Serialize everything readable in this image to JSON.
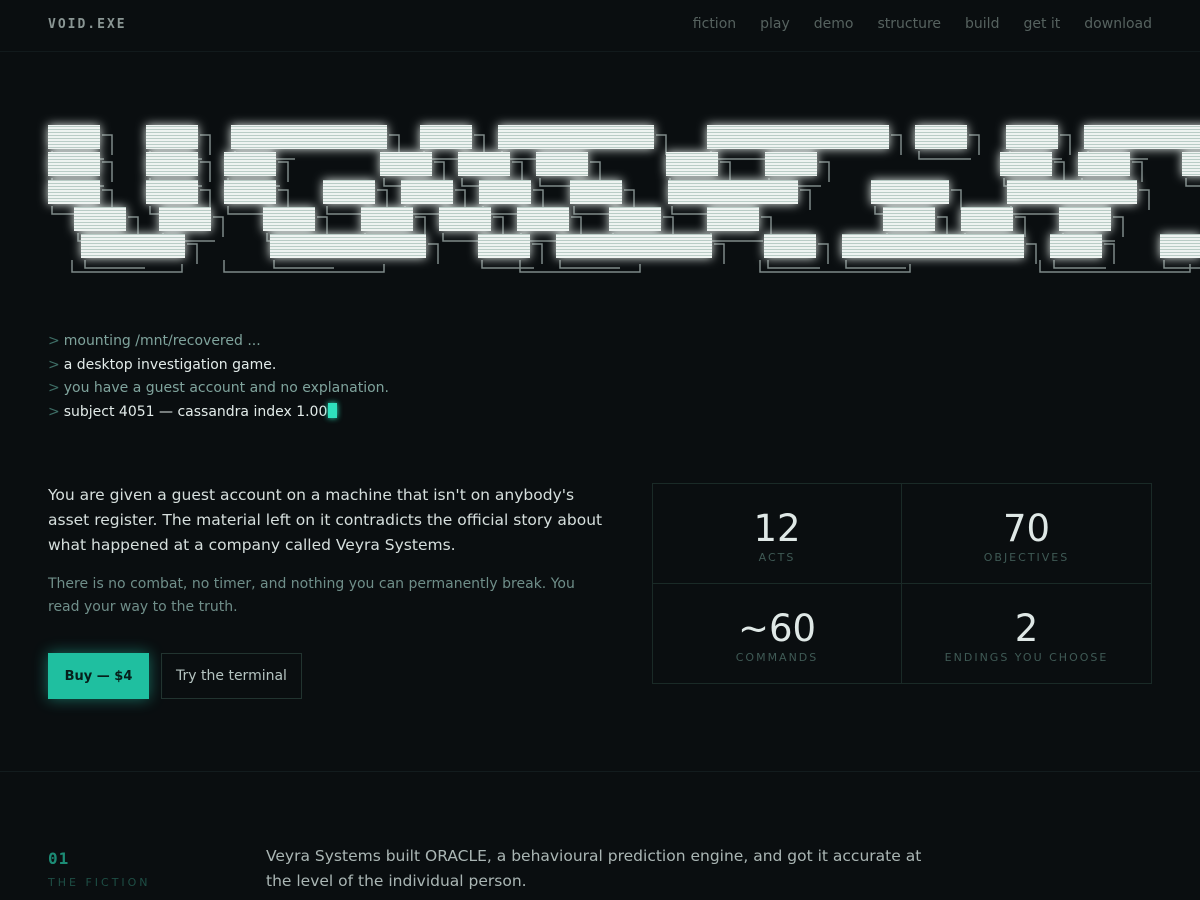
{
  "nav": {
    "brand": "VOID.EXE",
    "links": [
      "fiction",
      "play",
      "demo",
      "structure",
      "build",
      "get it",
      "download"
    ]
  },
  "terminal": {
    "prompt": ">",
    "lines": [
      "mounting /mnt/recovered ...",
      "a desktop investigation game.",
      "you have a guest account and no explanation.",
      "subject 4051 — cassandra index 1.00"
    ]
  },
  "intro": {
    "text": "You are given a guest account on a machine that isn't on anybody's asset register. The material left on it contradicts the official story about what happened at a company called Veyra Systems.",
    "sub": "There is no combat, no timer, and nothing you can permanently break. You read your way to the truth."
  },
  "buttons": {
    "buy": "Buy — $4",
    "try": "Try the terminal"
  },
  "stats": [
    {
      "value": "12",
      "label": "ACTS"
    },
    {
      "value": "70",
      "label": "OBJECTIVES"
    },
    {
      "value": "~60",
      "label": "COMMANDS"
    },
    {
      "value": "2",
      "label": "ENDINGS YOU CHOOSE"
    }
  ],
  "section": {
    "number": "01",
    "label": "THE FICTION",
    "text": "Veyra Systems built ORACLE, a behavioural prediction engine, and got it accurate at the level of the individual person."
  },
  "colors": {
    "background": "#0a0e10",
    "accent": "#1fbfa0",
    "glow": "#2fe0bd"
  }
}
